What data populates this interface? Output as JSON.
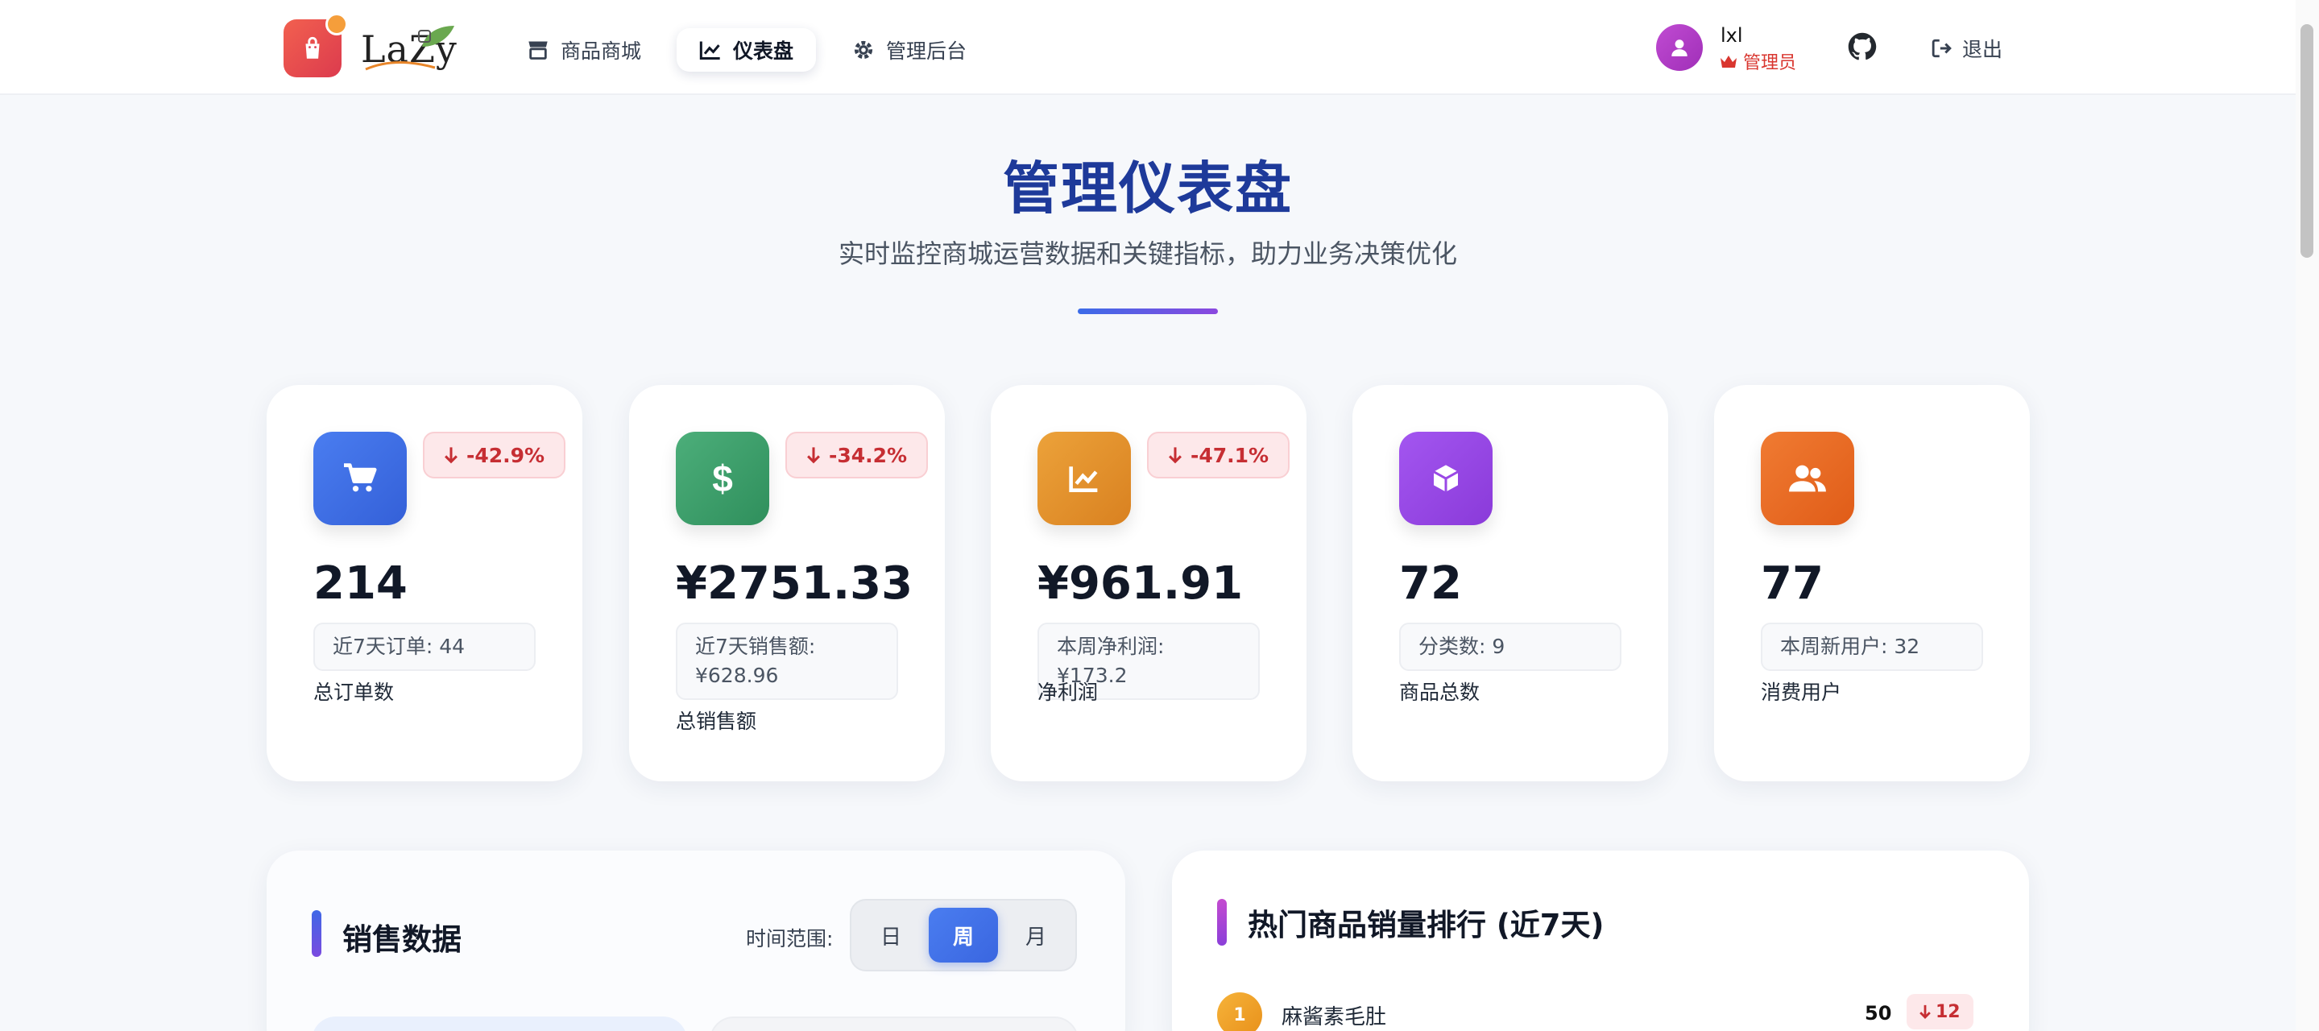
{
  "header": {
    "logo_text": "LaZy",
    "nav": [
      {
        "label": "商品商城"
      },
      {
        "label": "仪表盘"
      },
      {
        "label": "管理后台"
      }
    ],
    "user": {
      "name": "lxl",
      "role": "管理员"
    },
    "logout_label": "退出"
  },
  "hero": {
    "title": "管理仪表盘",
    "subtitle": "实时监控商城运营数据和关键指标，助力业务决策优化"
  },
  "stats": [
    {
      "icon": "cart-icon",
      "trend": "-42.9%",
      "value": "214",
      "sub": "近7天订单: 44",
      "label": "总订单数"
    },
    {
      "icon": "dollar-icon",
      "trend": "-34.2%",
      "value": "¥2751.33",
      "sub": "近7天销售额: ¥628.96",
      "label": "总销售额"
    },
    {
      "icon": "chart-line-icon",
      "trend": "-47.1%",
      "value": "¥961.91",
      "sub": "本周净利润: ¥173.2",
      "label": "净利润"
    },
    {
      "icon": "box-icon",
      "trend": "",
      "value": "72",
      "sub": "分类数: 9",
      "label": "商品总数"
    },
    {
      "icon": "users-icon",
      "trend": "",
      "value": "77",
      "sub": "本周新用户: 32",
      "label": "消费用户"
    }
  ],
  "sales_panel": {
    "title": "销售数据",
    "range_label": "时间范围:",
    "range_options": [
      "日",
      "周",
      "月"
    ],
    "selected_range": "周"
  },
  "hot_panel": {
    "title": "热门商品销量排行 (近7天)",
    "items": [
      {
        "rank": "1",
        "name": "麻酱素毛肚",
        "sales": "50",
        "trend": "12"
      }
    ]
  },
  "colors": {
    "primary": "#3a66e0",
    "title": "#1e3a9a",
    "danger": "#c62e33",
    "role": "#d9362f"
  }
}
